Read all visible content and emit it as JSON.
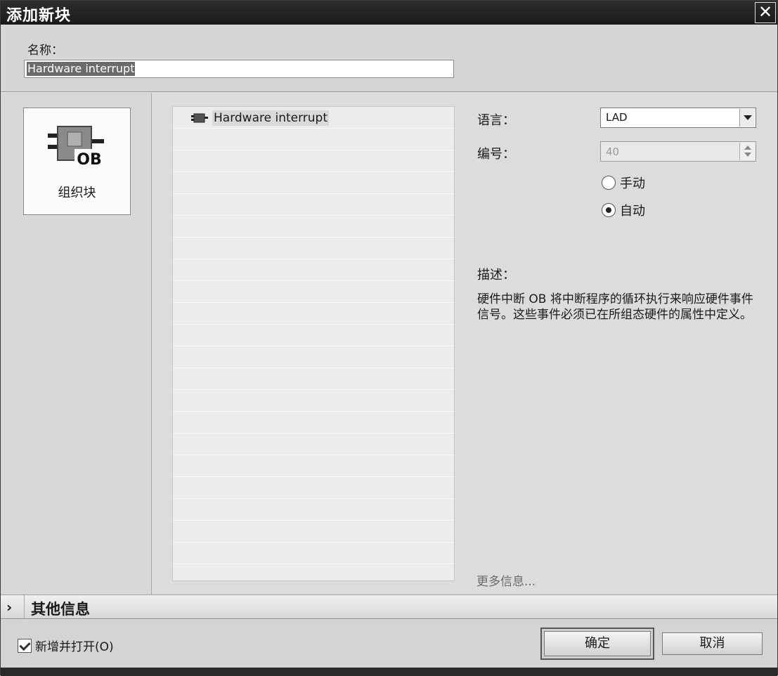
{
  "window": {
    "title": "添加新块"
  },
  "name": {
    "label": "名称：",
    "value": "Hardware interrupt"
  },
  "block_type": {
    "icon_text": "OB",
    "label": "组织块"
  },
  "block_list": [
    {
      "label": "Hardware interrupt"
    }
  ],
  "properties": {
    "language_label": "语言：",
    "language_value": "LAD",
    "number_label": "编号：",
    "number_value": "40",
    "manual_label": "手动",
    "auto_label": "自动",
    "selected_mode": "auto"
  },
  "description": {
    "label": "描述：",
    "text": "硬件中断 OB 将中断程序的循环执行来响应硬件事件信号。这些事件必须已在所组态硬件的属性中定义。",
    "more_info": "更多信息..."
  },
  "other_info": {
    "label": "其他信息"
  },
  "footer": {
    "add_open_label": "新增并打开(O)",
    "add_open_checked": true,
    "ok_label": "确定",
    "cancel_label": "取消"
  }
}
